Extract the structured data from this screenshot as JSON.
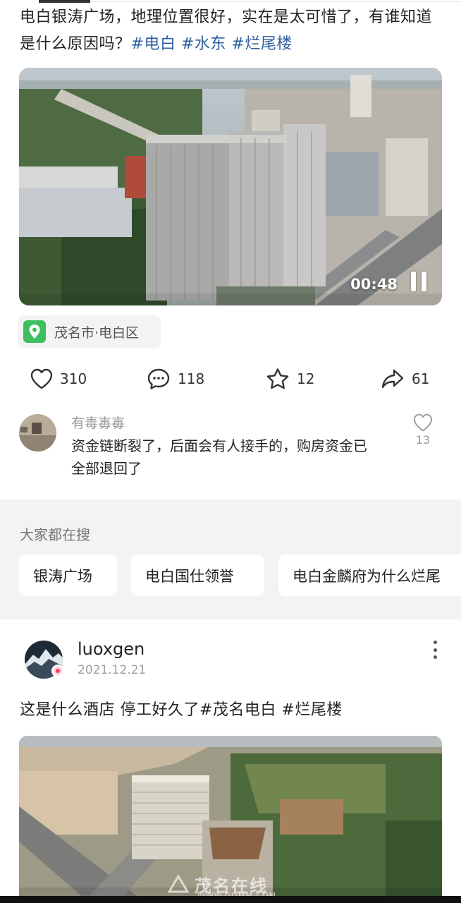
{
  "post1": {
    "text_main": "电白银涛广场，地理位置很好，实在是太可惜了，有谁知道是什么原因吗？",
    "tags": [
      "#电白",
      "#水东",
      "#烂尾楼"
    ],
    "video_time": "00:48",
    "location": "茂名市·电白区"
  },
  "actions": {
    "likes": "310",
    "comments": "118",
    "favorites": "12",
    "shares": "61"
  },
  "comment": {
    "user": "有毒毐毐",
    "text": "资金链断裂了，后面会有人接手的，购房资金已全部退回了",
    "likes": "13"
  },
  "search": {
    "title": "大家都在搜",
    "items": [
      "银涛广场",
      "电白国仕领誉",
      "电白金麟府为什么烂尾"
    ]
  },
  "post2": {
    "user": "luoxgen",
    "date": "2021.12.21",
    "text": "这是什么酒店  停工好久了#茂名电白 #烂尾楼",
    "watermark": "茂名在线",
    "watermark_url": "WWW.GDMM.COM"
  },
  "icons": {
    "location": "location-pin-icon",
    "like": "heart-icon",
    "comment": "chat-bubble-icon",
    "favorite": "star-icon",
    "share": "share-arrow-icon",
    "pause": "pause-icon",
    "more": "more-vertical-icon"
  },
  "colors": {
    "tag": "#2b5e9e",
    "location_icon": "#3cbf5c",
    "search_bg": "#f3f3f3"
  }
}
